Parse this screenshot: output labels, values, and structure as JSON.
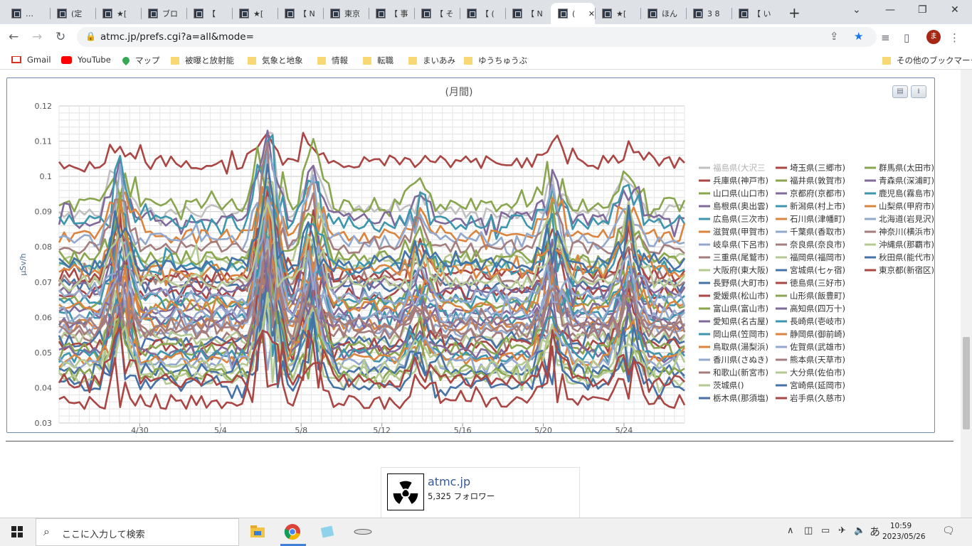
{
  "browser": {
    "tabs": [
      {
        "label": "…",
        "active": false
      },
      {
        "label": "(定",
        "active": false
      },
      {
        "label": "★[",
        "active": false
      },
      {
        "label": "ブロ",
        "active": false
      },
      {
        "label": "【",
        "active": false
      },
      {
        "label": "★[",
        "active": false
      },
      {
        "label": "【 N",
        "active": false
      },
      {
        "label": "東京",
        "active": false
      },
      {
        "label": "【 事",
        "active": false
      },
      {
        "label": "【 そ",
        "active": false
      },
      {
        "label": "【 (",
        "active": false
      },
      {
        "label": "【 N",
        "active": false
      },
      {
        "label": "(",
        "active": true
      },
      {
        "label": "★[",
        "active": false
      },
      {
        "label": "ほん",
        "active": false
      },
      {
        "label": "3 8",
        "active": false
      },
      {
        "label": "【 い",
        "active": false
      }
    ],
    "new_tab": "+",
    "url": "atmc.jp/prefs.cgi?a=all&mode=",
    "profile_initial": "ま",
    "bookmarks": [
      "Gmail",
      "YouTube",
      "マップ",
      "被曝と放射能",
      "気象と地象",
      "情報",
      "転職",
      "まいあみ",
      "ゆうちゅうぶ"
    ],
    "other_bookmarks": "その他のブックマーク"
  },
  "chart_data": {
    "type": "line",
    "title": "(月間)",
    "xlabel": "",
    "ylabel": "μSv/h",
    "ylim": [
      0.03,
      0.12
    ],
    "yticks": [
      "0.03",
      "0.04",
      "0.05",
      "0.06",
      "0.07",
      "0.08",
      "0.09",
      "0.1",
      "0.11",
      "0.12"
    ],
    "xticks": [
      "4/30",
      "5/4",
      "5/8",
      "5/12",
      "5/16",
      "5/20",
      "5/24"
    ],
    "x_start": "4/26",
    "x_end": "5/27",
    "grid": true,
    "legend_placement": "right",
    "series": [
      {
        "name": "福島県(大沢三",
        "color": "#c0c0c0",
        "base": 0.09
      },
      {
        "name": "兵庫県(神戸市)",
        "color": "#aa4643",
        "base": 0.104
      },
      {
        "name": "山口県(山口市)",
        "color": "#89a54e",
        "base": 0.092
      },
      {
        "name": "島根県(奥出雲)",
        "color": "#80699b",
        "base": 0.088
      },
      {
        "name": "広島県(三次市)",
        "color": "#3d96ae",
        "base": 0.087
      },
      {
        "name": "滋賀県(甲賀市)",
        "color": "#db843d",
        "base": 0.083
      },
      {
        "name": "岐阜県(下呂市)",
        "color": "#92a8cd",
        "base": 0.082
      },
      {
        "name": "三重県(尾鷲市)",
        "color": "#a47d7c",
        "base": 0.08
      },
      {
        "name": "大阪府(東大阪)",
        "color": "#b5ca92",
        "base": 0.076
      },
      {
        "name": "長野県(大町市)",
        "color": "#4572a7",
        "base": 0.069
      },
      {
        "name": "愛媛県(松山市)",
        "color": "#aa4643",
        "base": 0.067
      },
      {
        "name": "富山県(富山市)",
        "color": "#89a54e",
        "base": 0.064
      },
      {
        "name": "愛知県(名古屋)",
        "color": "#80699b",
        "base": 0.062
      },
      {
        "name": "岡山県(笠岡市)",
        "color": "#3d96ae",
        "base": 0.06
      },
      {
        "name": "鳥取県(湯梨浜)",
        "color": "#db843d",
        "base": 0.058
      },
      {
        "name": "香川県(さぬき)",
        "color": "#92a8cd",
        "base": 0.057
      },
      {
        "name": "和歌山(新宮市)",
        "color": "#a47d7c",
        "base": 0.055
      },
      {
        "name": "茨城県()",
        "color": "#b5ca92",
        "base": 0.054
      },
      {
        "name": "栃木県(那須塩)",
        "color": "#4572a7",
        "base": 0.053
      },
      {
        "name": "埼玉県(三郷市)",
        "color": "#aa4643",
        "base": 0.052
      },
      {
        "name": "福井県(敦賀市)",
        "color": "#89a54e",
        "base": 0.051
      },
      {
        "name": "京都府(京都市)",
        "color": "#80699b",
        "base": 0.05
      },
      {
        "name": "新潟県(村上市)",
        "color": "#3d96ae",
        "base": 0.049
      },
      {
        "name": "石川県(津幡町)",
        "color": "#db843d",
        "base": 0.048
      },
      {
        "name": "千葉県(香取市)",
        "color": "#92a8cd",
        "base": 0.047
      },
      {
        "name": "奈良県(奈良市)",
        "color": "#a47d7c",
        "base": 0.071
      },
      {
        "name": "福岡県(福岡市)",
        "color": "#b5ca92",
        "base": 0.046
      },
      {
        "name": "宮城県(七ヶ宿)",
        "color": "#4572a7",
        "base": 0.045
      },
      {
        "name": "徳島県(三好市)",
        "color": "#aa4643",
        "base": 0.072
      },
      {
        "name": "山形県(飯豊町)",
        "color": "#89a54e",
        "base": 0.044
      },
      {
        "name": "高知県(四万十)",
        "color": "#80699b",
        "base": 0.059
      },
      {
        "name": "長崎県(壱岐市)",
        "color": "#3d96ae",
        "base": 0.065
      },
      {
        "name": "静岡県(御前崎)",
        "color": "#db843d",
        "base": 0.063
      },
      {
        "name": "佐賀県(武雄市)",
        "color": "#92a8cd",
        "base": 0.061
      },
      {
        "name": "熊本県(天草市)",
        "color": "#a47d7c",
        "base": 0.056
      },
      {
        "name": "大分県(佐伯市)",
        "color": "#b5ca92",
        "base": 0.043
      },
      {
        "name": "宮崎県(延岡市)",
        "color": "#4572a7",
        "base": 0.041
      },
      {
        "name": "岩手県(久慈市)",
        "color": "#aa4643",
        "base": 0.036
      },
      {
        "name": "群馬県(太田市)",
        "color": "#89a54e",
        "base": 0.077
      },
      {
        "name": "青森県(深浦町)",
        "color": "#80699b",
        "base": 0.068
      },
      {
        "name": "鹿児島(霧島市)",
        "color": "#3d96ae",
        "base": 0.074
      },
      {
        "name": "山梨県(甲府市)",
        "color": "#db843d",
        "base": 0.073
      },
      {
        "name": "北海道(岩見沢)",
        "color": "#92a8cd",
        "base": 0.066
      },
      {
        "name": "神奈川(横浜市)",
        "color": "#a47d7c",
        "base": 0.058
      },
      {
        "name": "沖縄県(那覇市)",
        "color": "#b5ca92",
        "base": 0.07
      },
      {
        "name": "秋田県(能代市)",
        "color": "#4572a7",
        "base": 0.075
      },
      {
        "name": "東京都(新宿区)",
        "color": "#aa4643",
        "base": 0.042
      }
    ]
  },
  "fb": {
    "name": "atmc.jp",
    "followers": "5,325 フォロワー"
  },
  "taskbar": {
    "search_placeholder": "ここに入力して検索",
    "time": "10:59",
    "date": "2023/05/26",
    "ime": "あ"
  }
}
